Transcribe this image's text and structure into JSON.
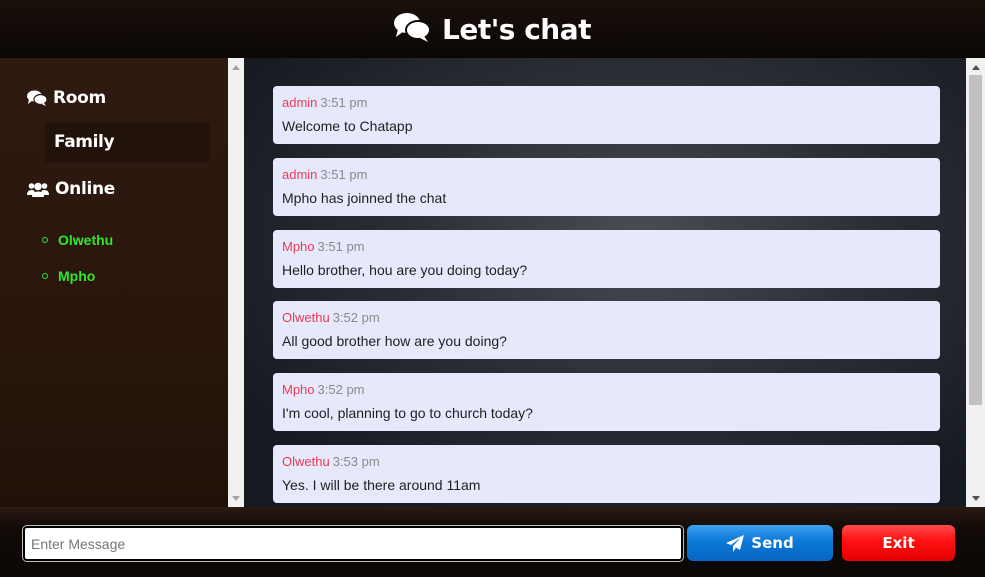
{
  "header": {
    "title": "Let's chat",
    "icon": "comments-icon"
  },
  "sidebar": {
    "room_label": "Room",
    "room_icon": "comments-icon",
    "room_name": "Family",
    "online_label": "Online",
    "online_icon": "users-icon",
    "users": [
      "Olwethu",
      "Mpho"
    ]
  },
  "messages": [
    {
      "author": "admin",
      "time": "3:51 pm",
      "text": "Welcome to Chatapp"
    },
    {
      "author": "admin",
      "time": "3:51 pm",
      "text": "Mpho has joinned the chat"
    },
    {
      "author": "Mpho",
      "time": "3:51 pm",
      "text": "Hello brother, hou are you doing today?"
    },
    {
      "author": "Olwethu",
      "time": "3:52 pm",
      "text": "All good brother how are you doing?"
    },
    {
      "author": "Mpho",
      "time": "3:52 pm",
      "text": "I'm cool, planning to go to church today?"
    },
    {
      "author": "Olwethu",
      "time": "3:53 pm",
      "text": "Yes. I will be there around 11am"
    }
  ],
  "composer": {
    "placeholder": "Enter Message",
    "value": "",
    "send_label": "Send",
    "send_icon": "paper-plane-icon",
    "exit_label": "Exit"
  },
  "colors": {
    "author": "#ec3b54",
    "online_user": "#2ee82e",
    "send_button": "#0a78d8",
    "exit_button": "#ff1010",
    "message_bubble": "#e6e9fc"
  }
}
